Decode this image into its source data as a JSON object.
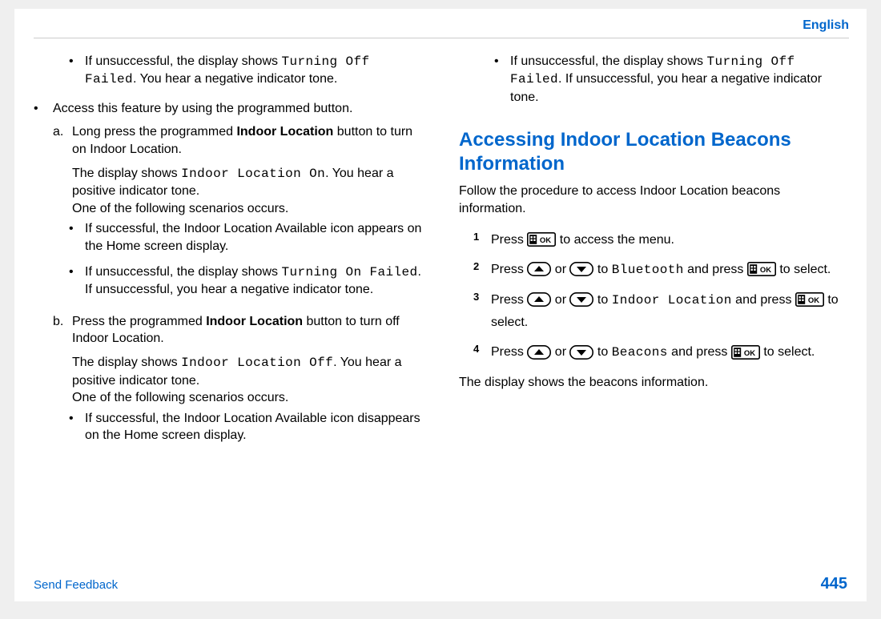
{
  "header": {
    "language": "English"
  },
  "left": {
    "b1_a": "If unsuccessful, the display shows ",
    "b1_code": "Turning Off Failed",
    "b1_b": ". You hear a negative indicator tone.",
    "outer": "Access this feature by using the programmed button.",
    "a": {
      "label": "a.",
      "line1_a": "Long press the programmed ",
      "line1_bold": "Indoor Location",
      "line1_b": " button to turn on Indoor Location.",
      "p1_a": "The display shows ",
      "p1_code": "Indoor Location On",
      "p1_b": ". You hear a positive indicator tone.",
      "p2": "One of the following scenarios occurs.",
      "sub1": "If successful, the Indoor Location Available icon appears on the Home screen display.",
      "sub2_a": "If unsuccessful, the display shows ",
      "sub2_code": "Turning On Failed",
      "sub2_b": ". If unsuccessful, you hear a negative indicator tone."
    },
    "b": {
      "label": "b.",
      "line1_a": "Press the programmed ",
      "line1_bold": "Indoor Location",
      "line1_b": " button to turn off Indoor Location.",
      "p1_a": "The display shows ",
      "p1_code": "Indoor Location Off",
      "p1_b": ". You hear a positive indicator tone.",
      "p2": "One of the following scenarios occurs.",
      "sub1": "If successful, the Indoor Location Available icon disappears on the Home screen display."
    }
  },
  "right": {
    "b1_a": "If unsuccessful, the display shows ",
    "b1_code": "Turning Off Failed",
    "b1_b": ". If unsuccessful, you hear a negative indicator tone.",
    "heading": "Accessing Indoor Location Beacons Information",
    "intro": "Follow the procedure to access Indoor Location beacons information.",
    "step1_a": "Press ",
    "step1_b": " to access the menu.",
    "step2_a": "Press ",
    "step2_or": " or ",
    "step2_to": " to ",
    "step2_code": "Bluetooth",
    "step2_and": " and press ",
    "step2_end": " to select.",
    "step3_a": "Press ",
    "step3_or": " or ",
    "step3_to": " to ",
    "step3_code": "Indoor Location",
    "step3_and": " and press ",
    "step3_end": " to select.",
    "step4_a": "Press ",
    "step4_or": " or ",
    "step4_to": " to ",
    "step4_code": "Beacons",
    "step4_and": " and press ",
    "step4_end": " to select.",
    "closing": "The display shows the beacons information."
  },
  "footer": {
    "feedback": "Send Feedback",
    "page": "445"
  },
  "nums": {
    "n1": "1",
    "n2": "2",
    "n3": "3",
    "n4": "4"
  }
}
